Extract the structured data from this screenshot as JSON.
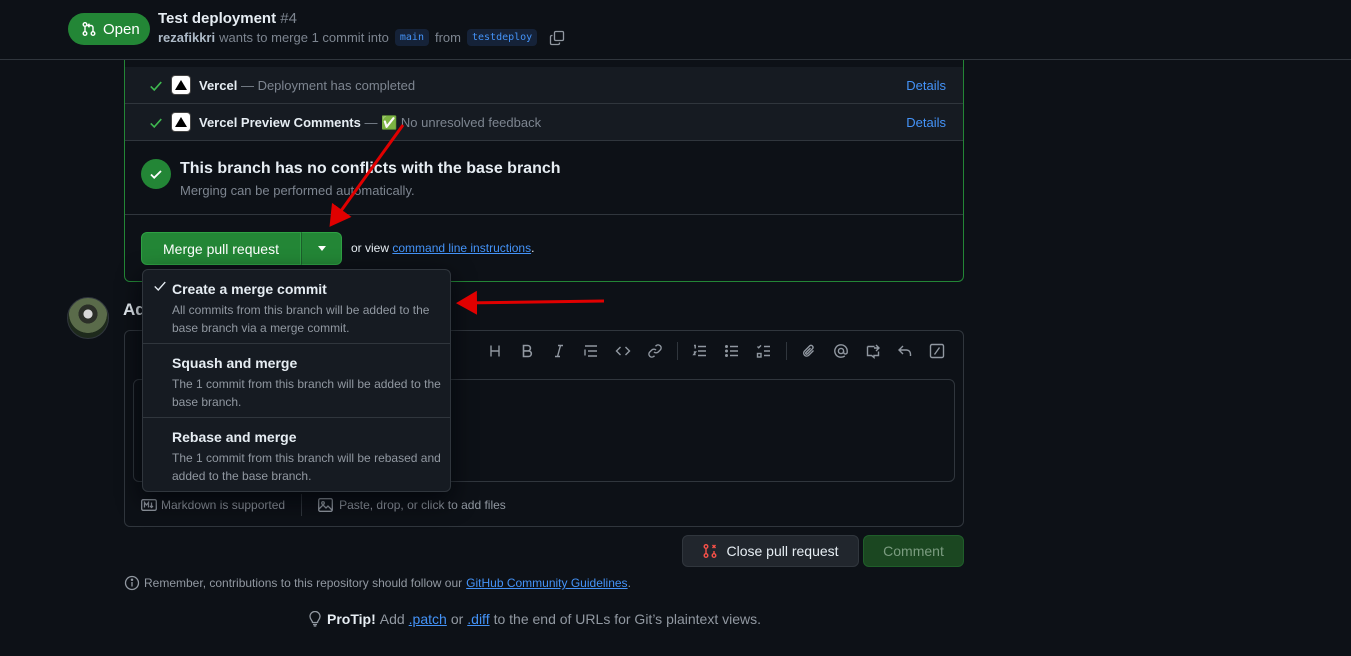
{
  "header": {
    "state": "Open",
    "title": "Test deployment",
    "number": "#4",
    "author": "rezafikkri",
    "meta_text": "wants to merge 1 commit into",
    "base_branch": "main",
    "from_text": "from",
    "head_branch": "testdeploy"
  },
  "checks": [
    {
      "name": "Vercel",
      "description": "— Deployment has completed",
      "details": "Details"
    },
    {
      "name": "Vercel Preview Comments",
      "description": "— ✅ No unresolved feedback",
      "details": "Details"
    }
  ],
  "merge_status": {
    "title": "This branch has no conflicts with the base branch",
    "subtitle": "Merging can be performed automatically."
  },
  "merge_actions": {
    "merge_button": "Merge pull request",
    "or_view": "or view",
    "cli_link": "command line instructions",
    "period": "."
  },
  "merge_dropdown": [
    {
      "title": "Create a merge commit",
      "description": "All commits from this branch will be added to the base branch via a merge commit.",
      "selected": true
    },
    {
      "title": "Squash and merge",
      "description": "The 1 commit from this branch will be added to the base branch.",
      "selected": false
    },
    {
      "title": "Rebase and merge",
      "description": "The 1 commit from this branch will be rebased and added to the base branch.",
      "selected": false
    }
  ],
  "comment": {
    "heading_partial": "Ad",
    "markdown_note": "Markdown is supported",
    "files_note": "Paste, drop, or click to add files",
    "close_button": "Close pull request",
    "comment_button": "Comment"
  },
  "guidelines": {
    "text": "Remember, contributions to this repository should follow our",
    "link": "GitHub Community Guidelines",
    "period": "."
  },
  "protip": {
    "label": "ProTip!",
    "text1": "Add",
    "patch": ".patch",
    "or": "or",
    "diff": ".diff",
    "text2": "to the end of URLs for Git’s plaintext views."
  },
  "colors": {
    "background": "#0d1117",
    "success_green": "#238636",
    "link_blue": "#4493f8",
    "annotation_red": "#e00000"
  }
}
